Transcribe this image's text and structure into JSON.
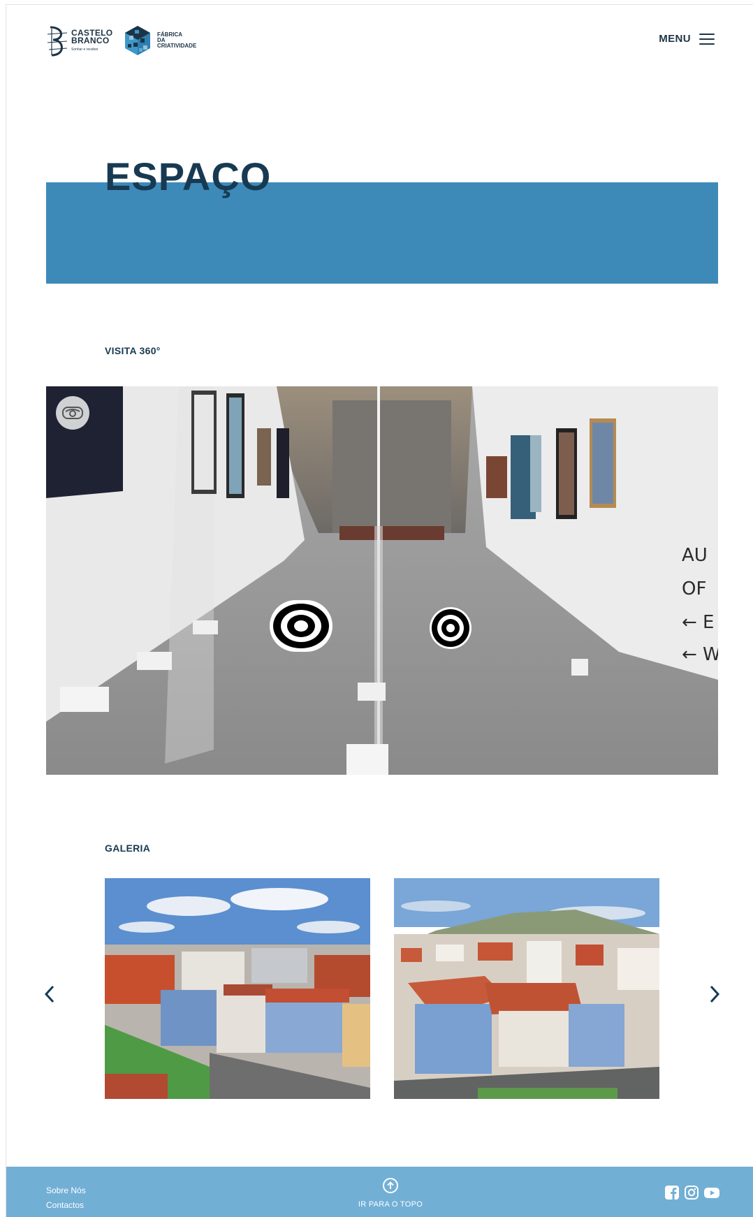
{
  "brand": {
    "cb_line1": "CASTELO",
    "cb_line2": "BRANCO",
    "cb_tagline": "Sonhar e receber",
    "fc_line1": "FÁBRICA",
    "fc_line2": "DA",
    "fc_line3": "CRIATIVIDADE"
  },
  "header": {
    "menu_label": "MENU",
    "menu_icon": "hamburger-icon"
  },
  "page": {
    "title": "ESPAÇO",
    "accent_color": "#3d8ab9"
  },
  "visit": {
    "label": "VISITA 360°",
    "vr_icon": "vr-headset-icon",
    "hotspot_icon": "target-icon",
    "wall_sign": "AU OF E W"
  },
  "gallery": {
    "label": "GALERIA",
    "prev_icon": "chevron-left-icon",
    "next_icon": "chevron-right-icon",
    "images": [
      {
        "alt": "Vista aérea 1"
      },
      {
        "alt": "Vista aérea 2"
      }
    ]
  },
  "footer": {
    "links": [
      "Sobre Nós",
      "Contactos"
    ],
    "to_top_label": "IR PARA O TOPO",
    "to_top_icon": "arrow-up-circle-icon",
    "social_icons": [
      "facebook-icon",
      "instagram-icon",
      "youtube-icon"
    ],
    "background": "#72afd5"
  }
}
